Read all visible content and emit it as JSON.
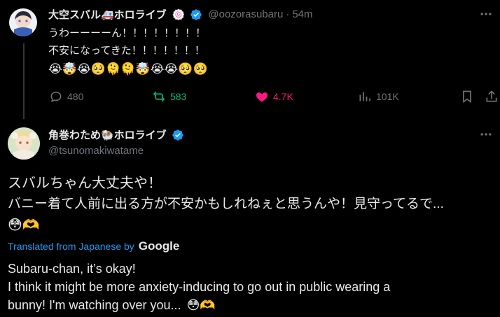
{
  "tweet1": {
    "name": "大空スバル🚑ホロライブ",
    "name_badge": "🍥",
    "handle": "@oozorasubaru",
    "sep": "·",
    "time": "54m",
    "lines": [
      "うわーーーーん！！！！！！！！",
      "不安になってきた！！！！！！！"
    ],
    "emojis": "😭🤯😭🥺🫠🫠🤯😭😭🥺🥺",
    "replies": "480",
    "retweets": "583",
    "likes": "4.7K",
    "views": "101K",
    "colors": {
      "retweet": "#00ba7c",
      "like": "#f91880",
      "verified": "#1d9bf0"
    }
  },
  "tweet2": {
    "name": "角巻わため🐏ホロライブ",
    "handle": "@tsunomakiwatame",
    "lines": [
      "スバルちゃん大丈夫や！",
      "バニー着て人前に出る方が不安かもしれねぇと思うんや！見守ってるで..."
    ],
    "emojis": "😳🫶",
    "translated_label": "Translated from Japanese by",
    "translator": "Google",
    "translation": [
      "Subaru-chan, it’s okay!",
      "I think it might be more anxiety-inducing to go out in public wearing a",
      "bunny! I'm watching over you..."
    ],
    "translation_emojis": "😳🫶"
  },
  "icons": [
    "avatar",
    "verified-icon",
    "more-icon",
    "reply-icon",
    "retweet-icon",
    "like-icon",
    "views-icon",
    "bookmark-icon",
    "share-icon"
  ]
}
